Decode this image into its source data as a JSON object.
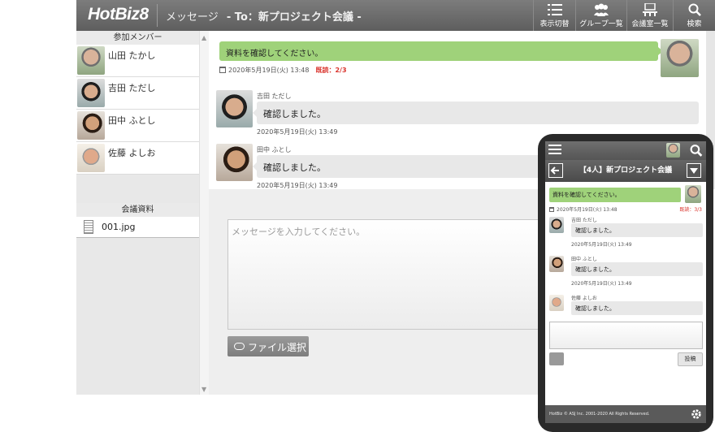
{
  "header": {
    "logo": "HotBiz8",
    "section": "メッセージ",
    "title": "- To：新プロジェクト会議 -",
    "buttons": [
      {
        "label": "表示切替",
        "icon": "list-icon"
      },
      {
        "label": "グループ一覧",
        "icon": "group-icon"
      },
      {
        "label": "会議室一覧",
        "icon": "meeting-room-icon"
      },
      {
        "label": "検索",
        "icon": "search-icon"
      }
    ]
  },
  "sidebar": {
    "members_heading": "参加メンバー",
    "members": [
      {
        "name": "山田 たかし"
      },
      {
        "name": "吉田 ただし"
      },
      {
        "name": "田中 ふとし"
      },
      {
        "name": "佐藤 よしお"
      }
    ],
    "files_heading": "会議資料",
    "files": [
      {
        "name": "001.jpg"
      }
    ]
  },
  "chat": {
    "my_message": {
      "text": "資料を確認してください。",
      "date": "2020年5月19日(火) 13:48",
      "read": "既読：2/3"
    },
    "messages": [
      {
        "sender": "吉田 ただし",
        "text": "確認しました。",
        "date": "2020年5月19日(火) 13:49"
      },
      {
        "sender": "田中 ふとし",
        "text": "確認しました。",
        "date": "2020年5月19日(火) 13:49"
      }
    ],
    "input_placeholder": "メッセージを入力してください。",
    "file_button": "ファイル選択"
  },
  "phone": {
    "title": "【4人】新プロジェクト会議",
    "my_message": {
      "text": "資料を確認してください。",
      "date": "2020年5月19日(火) 13:48",
      "read": "既読：3/3"
    },
    "messages": [
      {
        "sender": "吉田 ただし",
        "text": "確認しました。",
        "date": "2020年5月19日(火) 13:49"
      },
      {
        "sender": "田中 ふとし",
        "text": "確認しました。",
        "date": "2020年5月19日(火) 13:49"
      },
      {
        "sender": "佐藤 よしお",
        "text": "確認しました。"
      }
    ],
    "post_button": "投稿",
    "footer": "HotBiz © ASJ Inc. 2001-2020 All Rights Reserved."
  }
}
